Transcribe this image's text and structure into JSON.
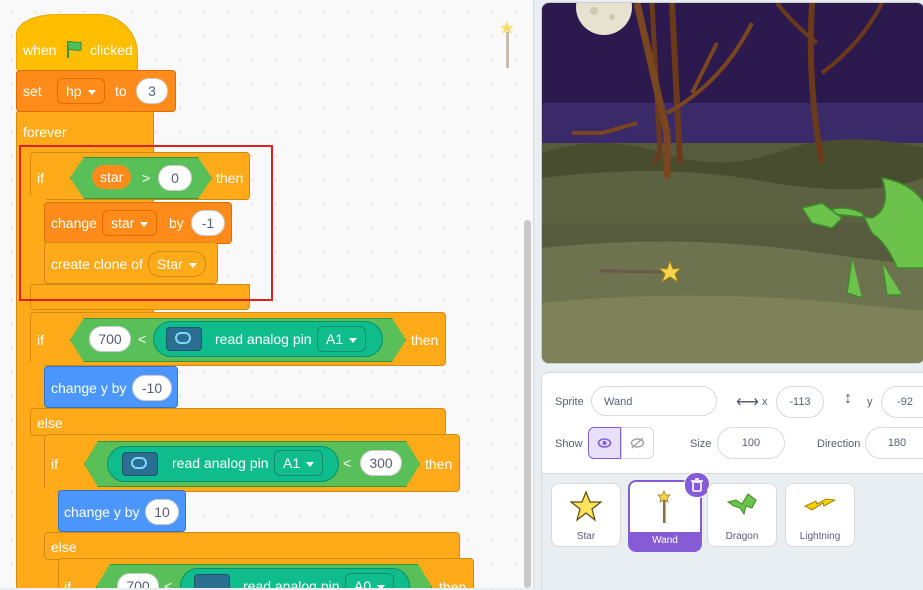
{
  "code": {
    "hat": {
      "when": "when",
      "clicked": "clicked"
    },
    "set_hp": {
      "set": "set",
      "var": "hp",
      "to": "to",
      "value": "3"
    },
    "forever": "forever",
    "if1": {
      "if": "if",
      "var": "star",
      "op": ">",
      "value": "0",
      "then": "then"
    },
    "change": {
      "change": "change",
      "var": "star",
      "by": "by",
      "value": "-1"
    },
    "clone": {
      "label": "create clone of",
      "target": "Star"
    },
    "if2": {
      "if": "if",
      "left": "700",
      "op": "<",
      "sensor": "read analog pin",
      "pin": "A1",
      "then": "then"
    },
    "change_y1": {
      "label": "change y by",
      "value": "-10"
    },
    "else1": "else",
    "if3": {
      "if": "if",
      "sensor": "read analog pin",
      "pin": "A1",
      "op": "<",
      "right": "300",
      "then": "then"
    },
    "change_y2": {
      "label": "change y by",
      "value": "10"
    },
    "else2": "else",
    "if4": {
      "if": "if",
      "left": "700",
      "op": "<",
      "sensor": "read analog pin",
      "pin": "A0",
      "then": "then"
    }
  },
  "sprite_info": {
    "sprite_label": "Sprite",
    "sprite_name": "Wand",
    "x_label": "x",
    "x_value": "-113",
    "y_label": "y",
    "y_value": "-92",
    "show_label": "Show",
    "size_label": "Size",
    "size_value": "100",
    "direction_label": "Direction",
    "direction_value": "180"
  },
  "sprites": [
    {
      "name": "Star",
      "icon": "star-icon"
    },
    {
      "name": "Wand",
      "icon": "wand-icon",
      "selected": true
    },
    {
      "name": "Dragon",
      "icon": "dragon-icon"
    },
    {
      "name": "Lightning",
      "icon": "lightning-icon"
    }
  ],
  "colors": {
    "events": "#ffbf00",
    "control": "#ffab19",
    "variables": "#ff8c1a",
    "motion": "#4c97ff",
    "operators": "#59c059",
    "extension": "#0fbd8c",
    "selected_sprite": "#855cd6",
    "highlight": "#e02020"
  }
}
